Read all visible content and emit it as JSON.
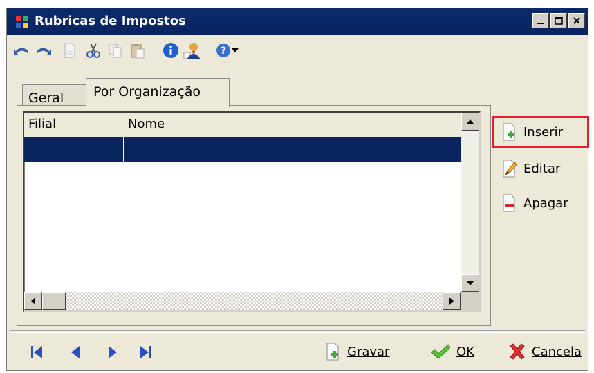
{
  "window": {
    "title": "Rubricas de Impostos"
  },
  "tabs": [
    {
      "label": "Geral"
    },
    {
      "label": "Por Organização"
    }
  ],
  "grid": {
    "columns": [
      {
        "label": "Filial"
      },
      {
        "label": "Nome"
      }
    ]
  },
  "actions": {
    "insert_label": "Inserir",
    "edit_label": "Editar",
    "delete_label": "Apagar"
  },
  "footer": {
    "save_label": "Gravar",
    "ok_label": "OK",
    "cancel_label": "Cancela"
  },
  "icons": {
    "toolbar": [
      "undo-icon",
      "redo-icon",
      "new-document-icon",
      "cut-icon",
      "copy-icon",
      "paste-icon",
      "info-icon",
      "user-icon",
      "help-icon",
      "dropdown-arrow-icon"
    ],
    "navigation": [
      "first-record-icon",
      "previous-record-icon",
      "next-record-icon",
      "last-record-icon"
    ]
  },
  "colors": {
    "titlebar": "#0a2460",
    "selection": "#0a2460",
    "highlight": "#e0202a"
  }
}
